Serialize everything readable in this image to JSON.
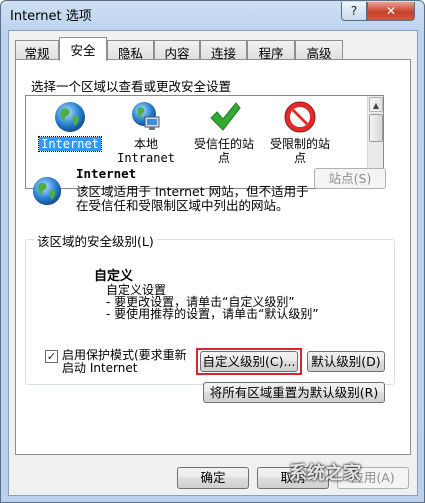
{
  "window": {
    "title": "Internet 选项",
    "help_button": "?",
    "close_button": "✕"
  },
  "tabs": [
    {
      "label": "常规"
    },
    {
      "label": "安全",
      "active": true
    },
    {
      "label": "隐私"
    },
    {
      "label": "内容"
    },
    {
      "label": "连接"
    },
    {
      "label": "程序"
    },
    {
      "label": "高级"
    }
  ],
  "zone_section": {
    "prompt": "选择一个区域以查看或更改安全设置",
    "zones": [
      {
        "icon": "globe-icon",
        "label": "Internet",
        "selected": true
      },
      {
        "icon": "local-intranet-icon",
        "label_line1": "本地",
        "label_line2": "Intranet"
      },
      {
        "icon": "green-check-icon",
        "label_line1": "受信任的站",
        "label_line2": "点"
      },
      {
        "icon": "no-entry-icon",
        "label_line1": "受限制的站",
        "label_line2": "点"
      }
    ]
  },
  "zone_info": {
    "name": "Internet",
    "desc_line1": "该区域适用于 Internet 网站，但不适用于",
    "desc_line2": "在受信任和受限制区域中列出的网站。",
    "sites_button": "站点(S)"
  },
  "security_level": {
    "group_label": "该区域的安全级别(L)",
    "level_name": "自定义",
    "line1": "自定义设置",
    "line2": "- 要更改设置，请单击“自定义级别”",
    "line3": "- 要使用推荐的设置，请单击“默认级别”"
  },
  "protected_mode": {
    "checked": true,
    "check_mark": "✓",
    "label_line1": "启用保护模式(要求重新",
    "label_line2": "启动 Internet"
  },
  "buttons": {
    "custom_level": "自定义级别(C)...",
    "default_level": "默认级别(D)",
    "reset_all": "将所有区域重置为默认级别(R)",
    "ok": "确定",
    "cancel": "取消",
    "apply": "应用(A)"
  },
  "watermark": {
    "text": "系统之家"
  },
  "colors": {
    "selection": "#3399ff",
    "highlight_border": "#d9262a"
  }
}
